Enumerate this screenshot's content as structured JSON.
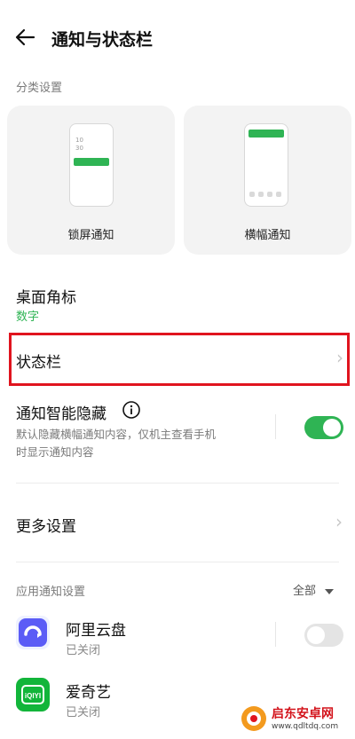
{
  "header": {
    "title": "通知与状态栏",
    "back_icon": "arrow-left-icon"
  },
  "category": {
    "label": "分类设置",
    "cards": [
      {
        "label": "锁屏通知",
        "time_line1": "10",
        "time_line2": "30"
      },
      {
        "label": "横幅通知"
      }
    ]
  },
  "desktop_badge": {
    "title": "桌面角标",
    "value": "数字"
  },
  "status_bar": {
    "title": "状态栏"
  },
  "smart_hide": {
    "title": "通知智能隐藏",
    "desc_line1": "默认隐藏横幅通知内容，仅机主查看手机",
    "desc_line2": "时显示通知内容",
    "enabled": true
  },
  "more_settings": {
    "title": "更多设置"
  },
  "app_section": {
    "label": "应用通知设置",
    "filter": "全部"
  },
  "apps": [
    {
      "name": "阿里云盘",
      "status": "已关闭",
      "icon_text": "阿里云盘"
    },
    {
      "name": "爱奇艺",
      "status": "已关闭",
      "icon_text": "iQIYI"
    }
  ],
  "watermark": {
    "brand": "启东安卓网",
    "url": "www.qdltdq.com"
  },
  "colors": {
    "accent": "#2fb454",
    "highlight": "#e0141e",
    "muted": "#7a7a7a"
  }
}
